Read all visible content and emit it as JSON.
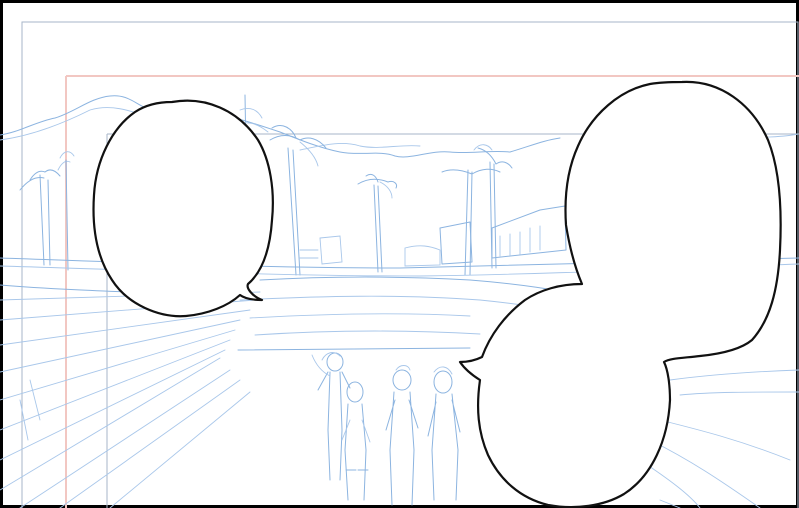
{
  "canvas": {
    "background_color": "#ffffff",
    "border_color": "#000000",
    "sketch_line_color": "#8cb4e0",
    "safe_area_guide_color": "#a7b6c8",
    "bleed_guide_color": "#f2c7c2",
    "balloon_outline_color": "#111111"
  },
  "scene": {
    "elements": [
      "distant-hills",
      "palm-trees",
      "buildings",
      "road-perspective-lines",
      "group-of-figures",
      "speech-balloon-left",
      "speech-balloon-right-double"
    ]
  }
}
